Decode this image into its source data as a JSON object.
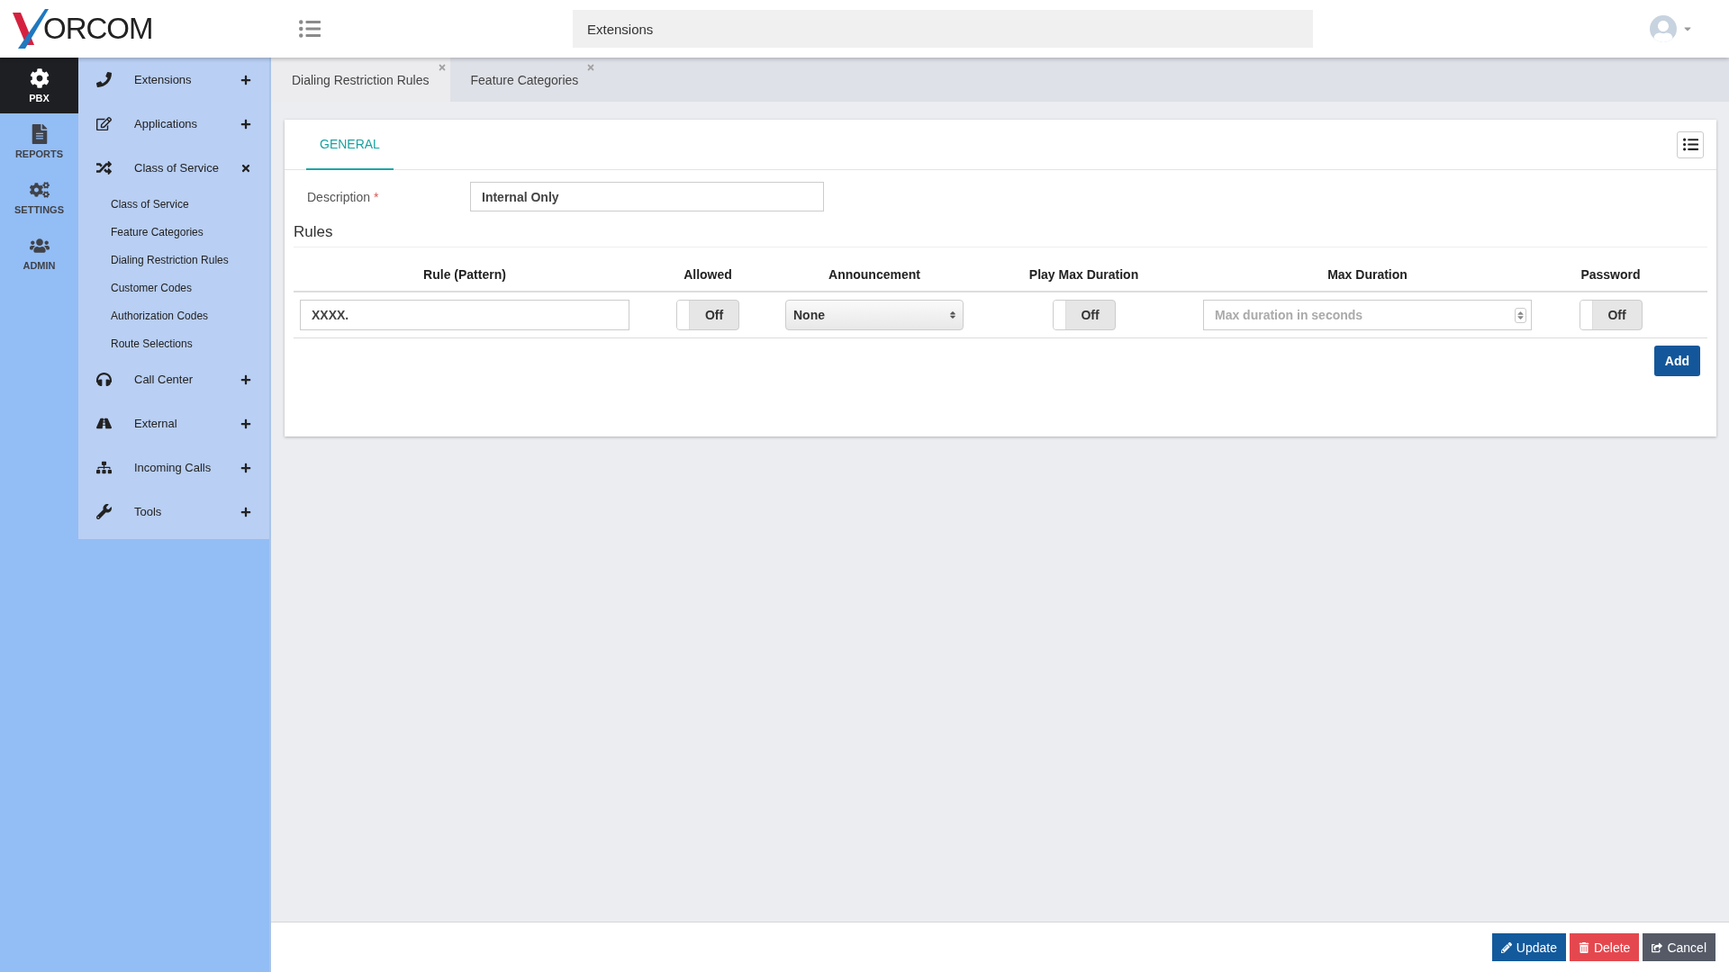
{
  "logo": {
    "text": "ORCOM"
  },
  "header": {
    "search": {
      "value": "Extensions"
    }
  },
  "rail": [
    {
      "label": "PBX",
      "selected": true
    },
    {
      "label": "REPORTS",
      "selected": false
    },
    {
      "label": "SETTINGS",
      "selected": false
    },
    {
      "label": "ADMIN",
      "selected": false
    }
  ],
  "menu": [
    {
      "label": "Extensions",
      "expanded": false
    },
    {
      "label": "Applications",
      "expanded": false
    },
    {
      "label": "Class of Service",
      "expanded": true,
      "children": [
        {
          "label": "Class of Service",
          "selected": false
        },
        {
          "label": "Feature Categories",
          "selected": false
        },
        {
          "label": "Dialing Restriction Rules",
          "selected": false
        },
        {
          "label": "Customer Codes",
          "selected": false
        },
        {
          "label": "Authorization Codes",
          "selected": false
        },
        {
          "label": "Route Selections",
          "selected": false
        }
      ]
    },
    {
      "label": "Call Center",
      "expanded": false
    },
    {
      "label": "External",
      "expanded": false
    },
    {
      "label": "Incoming Calls",
      "expanded": false
    },
    {
      "label": "Tools",
      "expanded": false
    }
  ],
  "tabs": [
    {
      "label": "Dialing Restriction Rules",
      "selected": true
    },
    {
      "label": "Feature Categories",
      "selected": false
    }
  ],
  "form": {
    "tabs": [
      {
        "label": "GENERAL",
        "selected": true
      }
    ],
    "description": {
      "label": "Description",
      "required_mark": "*",
      "value": "Internal Only"
    },
    "rules_title": "Rules",
    "columns": [
      "Rule (Pattern)",
      "Allowed",
      "Announcement",
      "Play Max Duration",
      "Max Duration",
      "Password"
    ],
    "rows": [
      [
        {
          "kind": "text",
          "value": "XXXX."
        },
        {
          "kind": "toggle",
          "on": false,
          "label": "Off"
        },
        {
          "kind": "select",
          "value": "None"
        },
        {
          "kind": "toggle",
          "on": false,
          "label": "Off"
        },
        {
          "kind": "number",
          "placeholder": "Max duration in seconds"
        },
        {
          "kind": "toggle",
          "on": false,
          "label": "Off"
        }
      ]
    ],
    "add_button": "Add"
  },
  "footer": [
    {
      "label": "Update",
      "kind": "primary"
    },
    {
      "label": "Delete",
      "kind": "danger"
    },
    {
      "label": "Cancel",
      "kind": "neutral"
    }
  ]
}
